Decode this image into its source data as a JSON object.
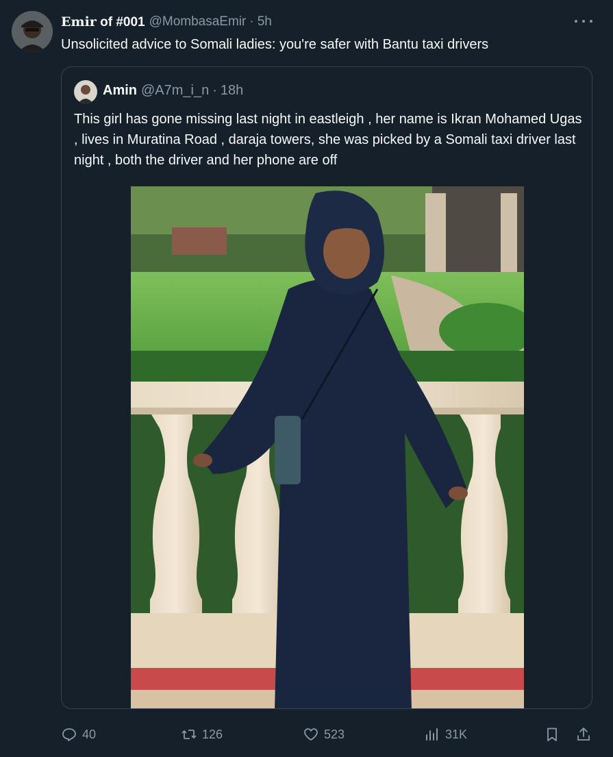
{
  "tweet": {
    "author": {
      "display_name_prefix": "Emir",
      "display_name_rest": " of #001",
      "handle": "@MombasaEmir",
      "time": "5h"
    },
    "text": "Unsolicited advice to Somali ladies: you're safer with Bantu taxi drivers",
    "quoted": {
      "display_name": "Amin",
      "handle": "@A7m_i_n",
      "time": "18h",
      "text": "This girl has gone  missing last night in eastleigh  , her name is Ikran Mohamed Ugas , lives in Muratina Road , daraja towers, she was picked by a  Somali taxi driver last night  , both the driver and her phone are off"
    },
    "actions": {
      "replies": "40",
      "retweets": "126",
      "likes": "523",
      "views": "31K"
    },
    "separator": "·"
  },
  "icons": {
    "more": "more-horizontal-icon",
    "reply": "reply-icon",
    "retweet": "retweet-icon",
    "like": "heart-icon",
    "views": "views-chart-icon",
    "bookmark": "bookmark-icon",
    "share": "share-icon"
  },
  "colors": {
    "background": "#15202b",
    "text": "#f7f9f9",
    "secondary": "#8b98a5",
    "border": "#38444d"
  }
}
